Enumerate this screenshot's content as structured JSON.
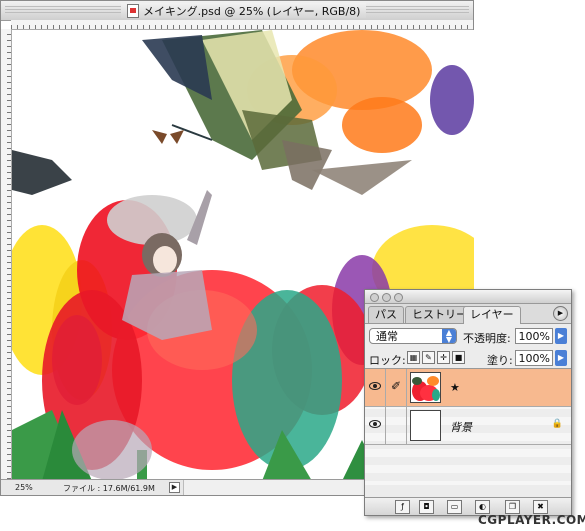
{
  "document": {
    "title": "メイキング.psd @ 25% (レイヤー, RGB/8)",
    "status_zoom": "25%",
    "status_file": "ファイル : 17.6M/61.9M"
  },
  "layers_palette": {
    "tabs": [
      {
        "label": "パス",
        "active": false
      },
      {
        "label": "ヒストリー",
        "active": false
      },
      {
        "label": "レイヤー",
        "active": true
      }
    ],
    "blend_mode": "通常",
    "opacity_label": "不透明度:",
    "opacity_value": "100%",
    "lock_label": "ロック:",
    "fill_label": "塗り:",
    "fill_value": "100%",
    "layers": [
      {
        "name": "★",
        "selected": true,
        "visible": true,
        "highlight_color": "#f7b98f"
      },
      {
        "name": "背景",
        "selected": false,
        "visible": true,
        "locked": true
      }
    ]
  },
  "watermark": "CGPLAYER.COM",
  "colors": {
    "selected_layer": "#f7b98f",
    "accent_blue": "#4a7fd6"
  }
}
